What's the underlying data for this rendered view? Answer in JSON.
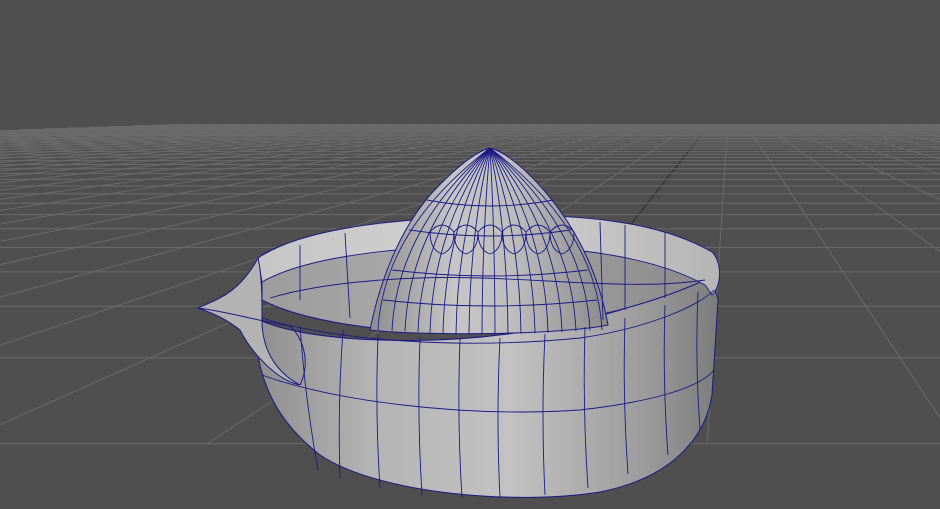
{
  "viewport": {
    "background": "#4f4f4f",
    "grid_color": "#6a6a6a",
    "grid_axis_color": "#353535",
    "wireframe_color": "#1c1a86"
  },
  "scene": {
    "objects": [
      {
        "name": "juicer-bowl",
        "shading": "#a9a9a9"
      },
      {
        "name": "juicer-reamer-cone",
        "shading": "#b9b9b9"
      },
      {
        "name": "juicer-spout",
        "shading": "#b0b0b0"
      }
    ],
    "grid_visible": true,
    "wireframe_on_shaded": true
  }
}
